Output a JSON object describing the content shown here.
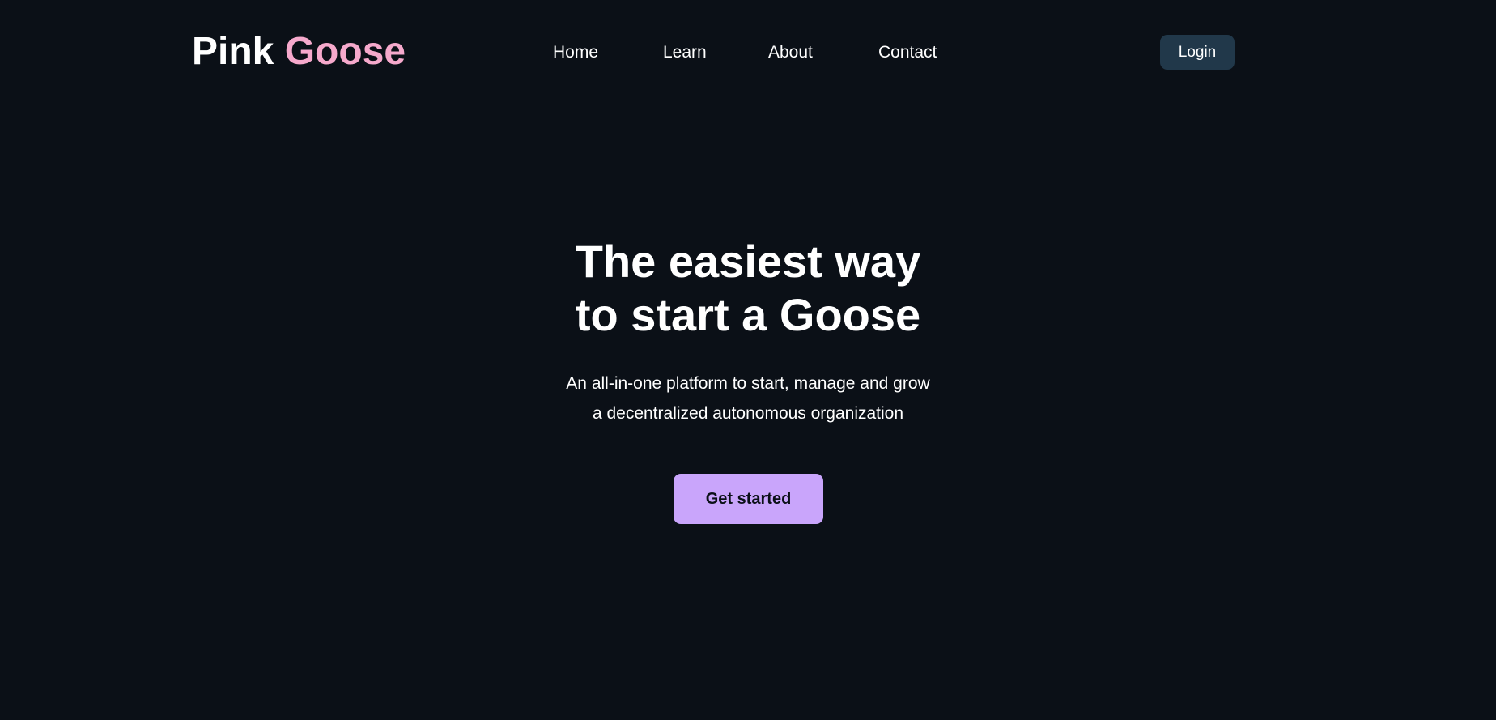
{
  "brand": {
    "first": "Pink",
    "second": "Goose",
    "accent_color": "#f6a9cc"
  },
  "nav": {
    "items": [
      {
        "label": "Home"
      },
      {
        "label": "Learn"
      },
      {
        "label": "About"
      },
      {
        "label": "Contact"
      }
    ],
    "login_label": "Login"
  },
  "hero": {
    "headline_line1": "The easiest way",
    "headline_line2": "to start a Goose",
    "sub_line1": "An all-in-one platform to start, manage and grow",
    "sub_line2": "a decentralized autonomous organization",
    "cta_label": "Get started"
  },
  "colors": {
    "background": "#0b1017",
    "login_button": "#21384a",
    "cta_button": "#c9a5fb"
  }
}
